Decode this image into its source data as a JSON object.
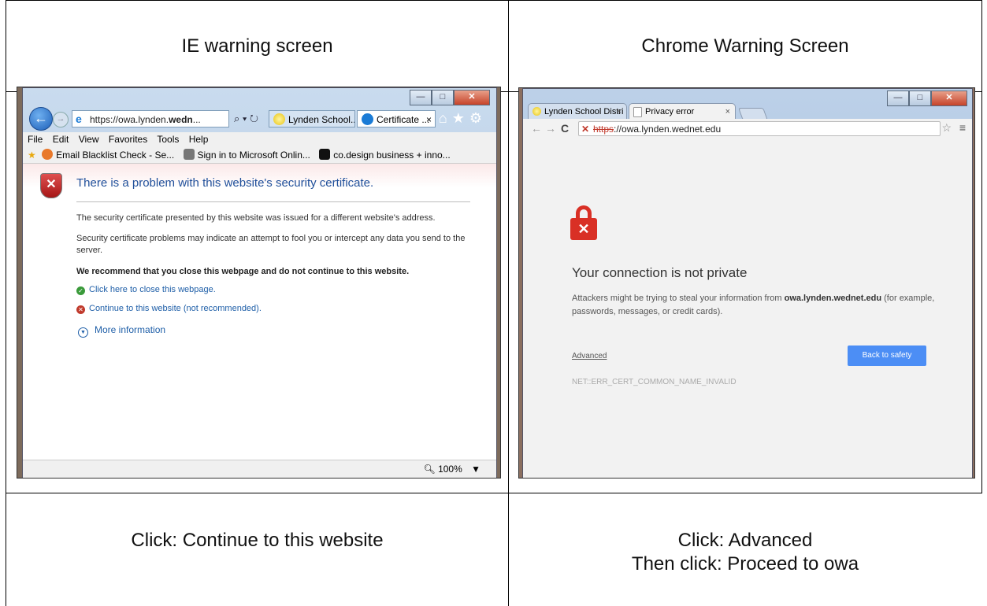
{
  "table": {
    "header_left": "IE warning screen",
    "header_right": "Chrome Warning Screen",
    "caption_left": "Click: Continue to this website",
    "caption_right_line1": "Click: Advanced",
    "caption_right_line2": "Then click: Proceed to owa"
  },
  "ie": {
    "url_prefix": "https://owa.lynden.",
    "url_bold": "wedn",
    "url_suffix": "...",
    "search_glyph": "⌕ ▾ ↻",
    "tabs": [
      {
        "label": "Lynden School..."
      },
      {
        "label": "Certificate ...",
        "close": "×"
      }
    ],
    "menu": [
      "File",
      "Edit",
      "View",
      "Favorites",
      "Tools",
      "Help"
    ],
    "favorites": [
      {
        "label": "Email Blacklist Check - Se...",
        "color": "#e8782a"
      },
      {
        "label": "Sign in to Microsoft Onlin...",
        "color": "#777777"
      },
      {
        "label": "co.design business + inno...",
        "color": "#111111"
      }
    ],
    "heading": "There is a problem with this website's security certificate.",
    "para1": "The security certificate presented by this website was issued for a different website's address.",
    "para2": "Security certificate problems may indicate an attempt to fool you or intercept any data you send to the server.",
    "recommend": "We recommend that you close this webpage and do not continue to this website.",
    "link_close": "Click here to close this webpage.",
    "link_continue": "Continue to this website (not recommended).",
    "more_info": "More information",
    "zoom": "100%",
    "colors": {
      "heading": "#1f4f9a",
      "link": "#1f5fa8"
    }
  },
  "chrome": {
    "tab1": "Lynden School Distri",
    "tab2": "Privacy error",
    "tab_close": "×",
    "url_scheme": "https",
    "url_rest": "://owa.lynden.wednet.edu",
    "heading": "Your connection is not private",
    "para_prefix": "Attackers might be trying to steal your information from ",
    "para_domain": "owa.lynden.wednet.edu",
    "para_suffix": " (for example, passwords, messages, or credit cards).",
    "advanced": "Advanced",
    "back_button": "Back to safety",
    "error_code": "NET::ERR_CERT_COMMON_NAME_INVALID",
    "colors": {
      "lock": "#d93025",
      "button": "#4c8ef5"
    }
  }
}
